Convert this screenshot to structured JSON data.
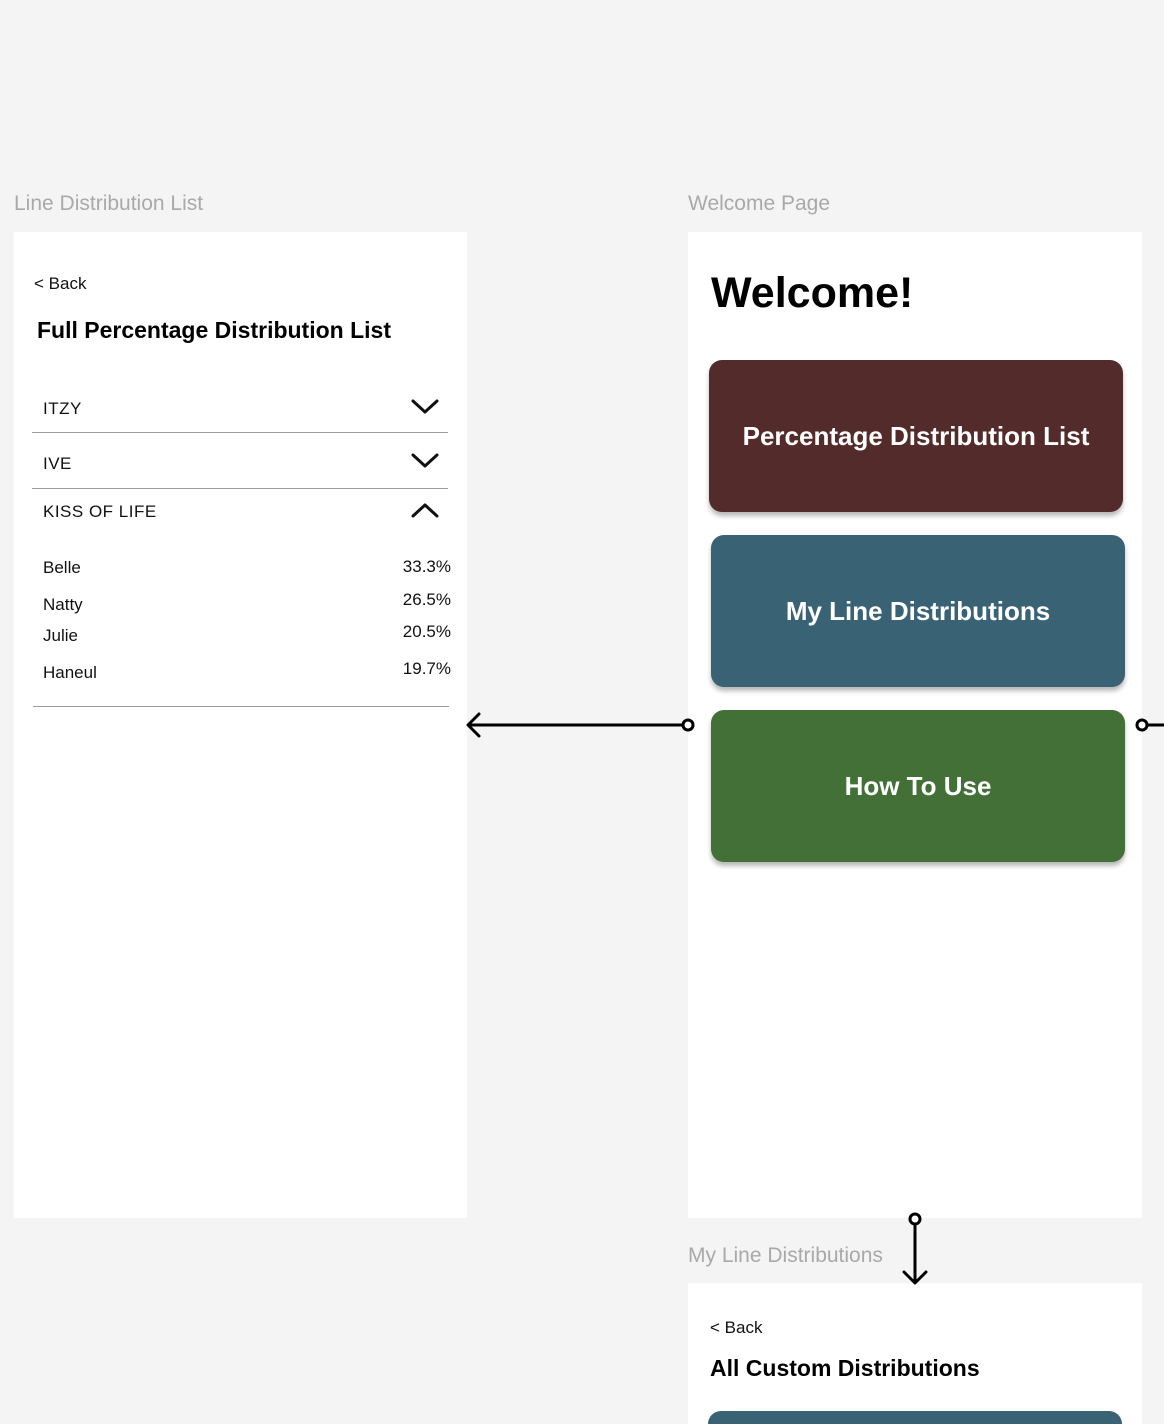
{
  "frames": {
    "line_distribution_list": {
      "label": "Line Distribution List",
      "back_label": "< Back",
      "title": "Full Percentage Distribution List",
      "groups": [
        {
          "name": "ITZY",
          "expanded": false,
          "chevron_icon": "chevron-down-icon"
        },
        {
          "name": "IVE",
          "expanded": false,
          "chevron_icon": "chevron-down-icon"
        },
        {
          "name": "KISS OF LIFE",
          "expanded": true,
          "chevron_icon": "chevron-up-icon",
          "members": [
            {
              "name": "Belle",
              "percent": "33.3%"
            },
            {
              "name": "Natty",
              "percent": "26.5%"
            },
            {
              "name": "Julie",
              "percent": "20.5%"
            },
            {
              "name": "Haneul",
              "percent": "19.7%"
            }
          ]
        }
      ]
    },
    "welcome_page": {
      "label": "Welcome Page",
      "title": "Welcome!",
      "buttons": [
        {
          "label": "Percentage Distribution List",
          "color": "#542b2b"
        },
        {
          "label": "My Line Distributions",
          "color": "#3a6275"
        },
        {
          "label": "How To Use",
          "color": "#427037"
        }
      ]
    },
    "my_line_distributions": {
      "label": "My Line Distributions",
      "back_label": "< Back",
      "title": "All Custom Distributions",
      "card_color": "#3a6275"
    }
  },
  "colors": {
    "canvas_background": "#f4f4f4",
    "frame_background": "#ffffff",
    "frame_label": "#a9a9a9",
    "connector": "#000000"
  }
}
